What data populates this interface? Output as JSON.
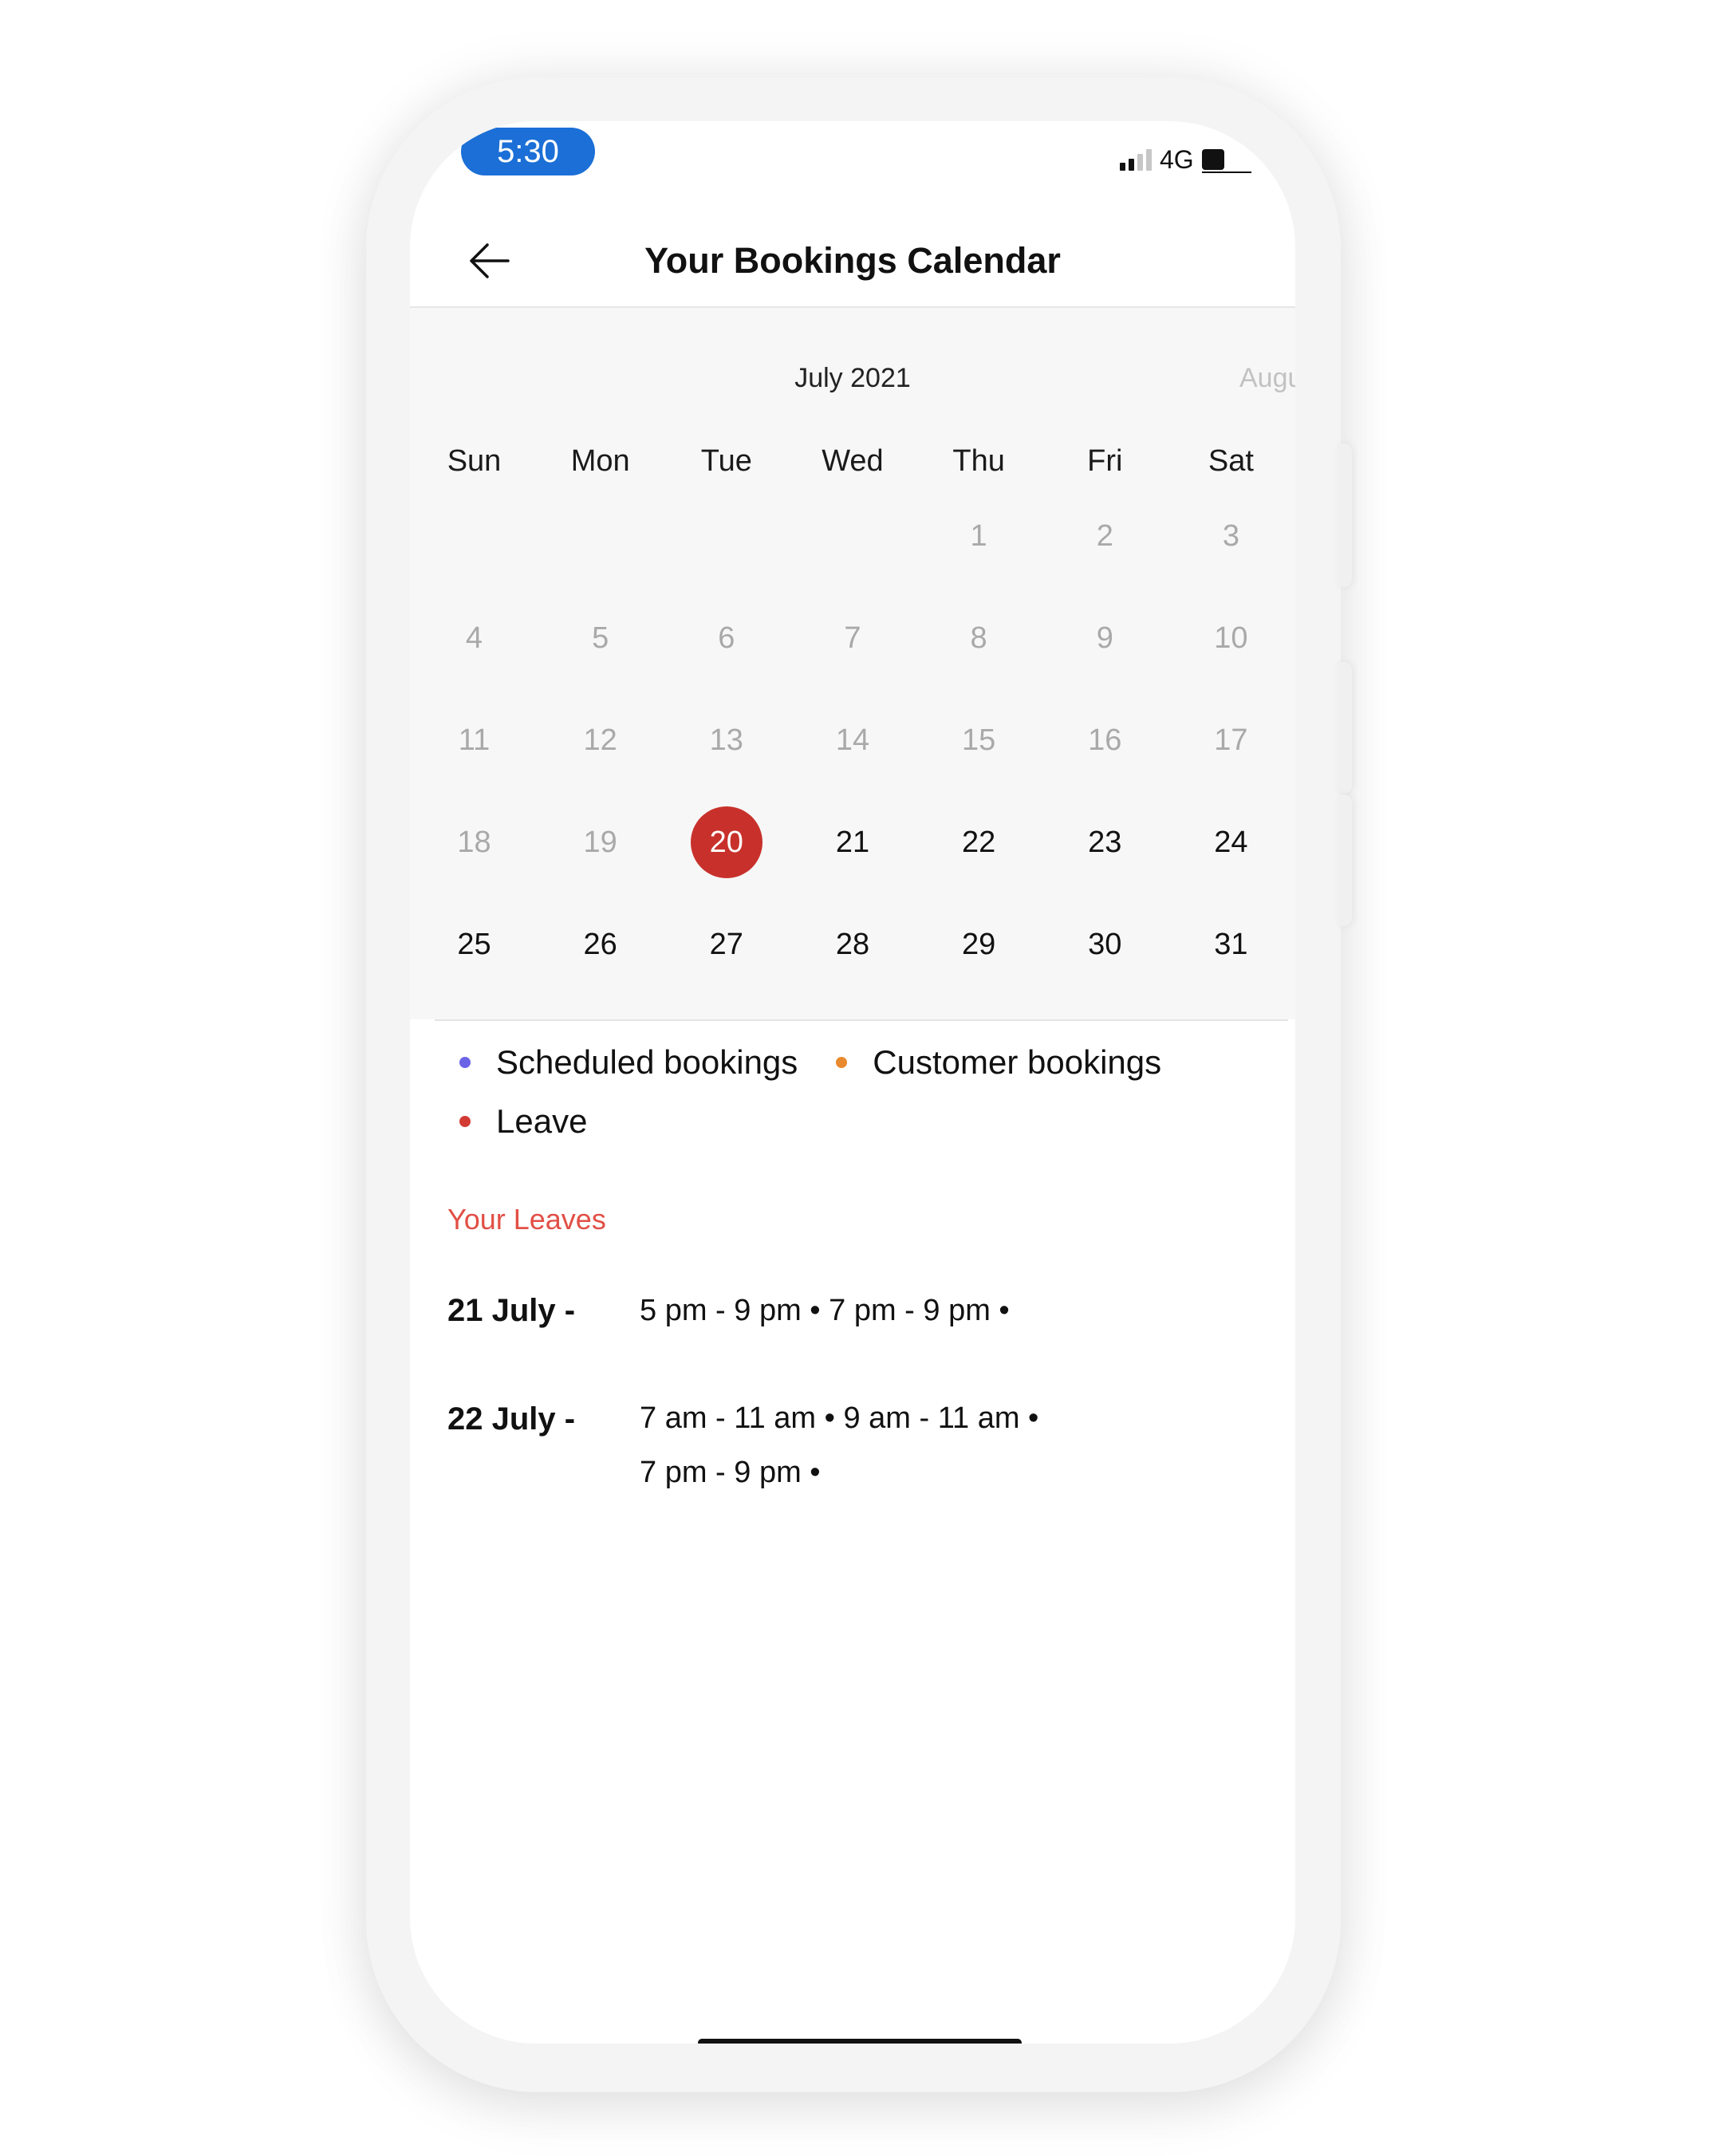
{
  "status_bar": {
    "time": "5:30",
    "network": "4G"
  },
  "header": {
    "title": "Your Bookings Calendar"
  },
  "calendar": {
    "month": "July 2021",
    "next_month_peek": "Augu",
    "weekdays": [
      "Sun",
      "Mon",
      "Tue",
      "Wed",
      "Thu",
      "Fri",
      "Sat"
    ],
    "selected_day": "20",
    "weeks": [
      [
        {
          "d": "",
          "past": true
        },
        {
          "d": "",
          "past": true
        },
        {
          "d": "",
          "past": true
        },
        {
          "d": "",
          "past": true
        },
        {
          "d": "1",
          "past": true
        },
        {
          "d": "2",
          "past": true
        },
        {
          "d": "3",
          "past": true
        }
      ],
      [
        {
          "d": "4",
          "past": true
        },
        {
          "d": "5",
          "past": true
        },
        {
          "d": "6",
          "past": true
        },
        {
          "d": "7",
          "past": true
        },
        {
          "d": "8",
          "past": true
        },
        {
          "d": "9",
          "past": true
        },
        {
          "d": "10",
          "past": true
        }
      ],
      [
        {
          "d": "11",
          "past": true
        },
        {
          "d": "12",
          "past": true
        },
        {
          "d": "13",
          "past": true
        },
        {
          "d": "14",
          "past": true
        },
        {
          "d": "15",
          "past": true
        },
        {
          "d": "16",
          "past": true
        },
        {
          "d": "17",
          "past": true
        }
      ],
      [
        {
          "d": "18",
          "past": true
        },
        {
          "d": "19",
          "past": true
        },
        {
          "d": "20",
          "past": false
        },
        {
          "d": "21",
          "past": false
        },
        {
          "d": "22",
          "past": false
        },
        {
          "d": "23",
          "past": false
        },
        {
          "d": "24",
          "past": false
        }
      ],
      [
        {
          "d": "25",
          "past": false
        },
        {
          "d": "26",
          "past": false
        },
        {
          "d": "27",
          "past": false
        },
        {
          "d": "28",
          "past": false
        },
        {
          "d": "29",
          "past": false
        },
        {
          "d": "30",
          "past": false
        },
        {
          "d": "31",
          "past": false
        }
      ]
    ]
  },
  "legend": {
    "scheduled": {
      "label": "Scheduled bookings",
      "color": "#6b63e6"
    },
    "customer": {
      "label": "Customer bookings",
      "color": "#e98a2f"
    },
    "leave": {
      "label": "Leave",
      "color": "#d23b34"
    }
  },
  "leaves": {
    "heading": "Your Leaves",
    "entries": [
      {
        "date": "21 July -",
        "lines": [
          "5 pm - 9 pm • 7 pm - 9 pm •"
        ]
      },
      {
        "date": "22 July -",
        "lines": [
          "7 am - 11 am • 9 am - 11 am •",
          "7 pm - 9 pm •"
        ]
      }
    ]
  },
  "colors": {
    "accent_selected": "#c8312b",
    "leaves_heading": "#e24f45",
    "time_pill": "#1b6fd6"
  },
  "icons": {
    "back": "left-arrow-icon",
    "signal": "signal-bars-icon",
    "battery": "battery-icon"
  }
}
